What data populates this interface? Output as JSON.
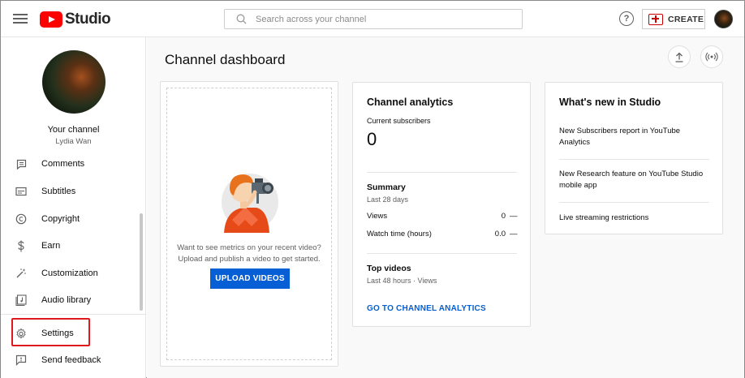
{
  "app": {
    "name": "Studio"
  },
  "header": {
    "search_placeholder": "Search across your channel",
    "help_symbol": "?",
    "create_label": "CREATE"
  },
  "sidebar": {
    "channel_label": "Your channel",
    "channel_name": "Lydia Wan",
    "items": [
      {
        "label": "Comments",
        "icon": "comments-icon"
      },
      {
        "label": "Subtitles",
        "icon": "subtitles-icon"
      },
      {
        "label": "Copyright",
        "icon": "copyright-icon"
      },
      {
        "label": "Earn",
        "icon": "dollar-icon"
      },
      {
        "label": "Customization",
        "icon": "magic-wand-icon"
      },
      {
        "label": "Audio library",
        "icon": "audio-library-icon"
      }
    ],
    "bottom_items": [
      {
        "label": "Settings",
        "icon": "gear-icon",
        "highlighted": true
      },
      {
        "label": "Send feedback",
        "icon": "feedback-icon"
      }
    ]
  },
  "main": {
    "title": "Channel dashboard",
    "upload_card": {
      "text": "Want to see metrics on your recent video? Upload and publish a video to get started.",
      "button": "UPLOAD VIDEOS"
    },
    "analytics": {
      "title": "Channel analytics",
      "subscribers_label": "Current subscribers",
      "subscribers_value": "0",
      "summary_title": "Summary",
      "summary_period": "Last 28 days",
      "rows": [
        {
          "label": "Views",
          "value": "0",
          "change": "—"
        },
        {
          "label": "Watch time (hours)",
          "value": "0.0",
          "change": "—"
        }
      ],
      "top_videos_title": "Top videos",
      "top_videos_period": "Last 48 hours · Views",
      "link": "GO TO CHANNEL ANALYTICS"
    },
    "whats_new": {
      "title": "What's new in Studio",
      "items": [
        "New Subscribers report in YouTube Analytics",
        "New Research feature on YouTube Studio mobile app",
        "Live streaming restrictions"
      ]
    }
  },
  "colors": {
    "brand_red": "#ff0000",
    "link_blue": "#065fd4",
    "highlight_border": "#e0191f"
  }
}
